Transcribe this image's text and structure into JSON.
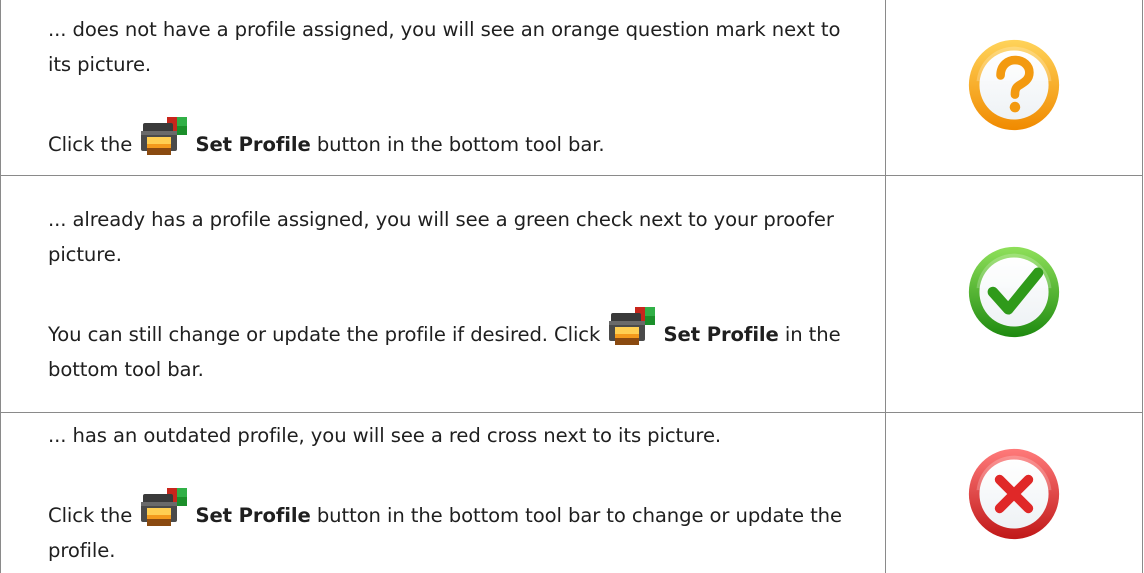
{
  "rows": [
    {
      "text_1": "... does not have a profile assigned, you will see an orange question mark next to its picture.",
      "text_2_prefix": "Click the",
      "text_2_bold": "Set Profile",
      "text_2_suffix": " button in the bottom tool bar.",
      "status_icon": "orange-question-mark-icon"
    },
    {
      "text_1": "... already has a profile assigned, you will see a green check next to your proofer picture.",
      "text_2_prefix": "You can still change or update the profile if desired. Click",
      "text_2_bold": "Set Profile",
      "text_2_suffix": " in the bottom tool bar.",
      "status_icon": "green-check-icon"
    },
    {
      "text_1": "... has an outdated profile, you will see a red cross next to its picture.",
      "text_2_prefix": "Click the",
      "text_2_bold": "Set Profile",
      "text_2_suffix": " button in the bottom tool bar to change or update the profile.",
      "status_icon": "red-cross-icon"
    }
  ],
  "toolbar_icon": "set-profile-icon",
  "colors": {
    "border": "#8a8a8a",
    "question": "#f5a623",
    "check": "#3fae1c",
    "cross": "#e03131"
  }
}
